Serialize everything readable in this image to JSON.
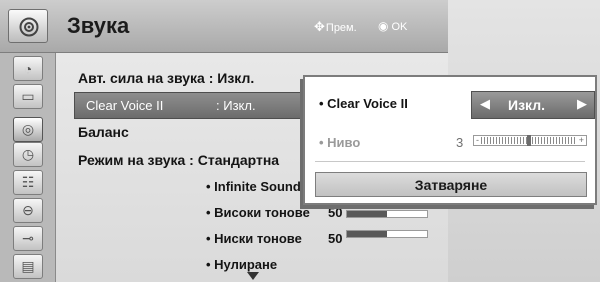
{
  "header": {
    "title": "Звука",
    "icon": "speaker-icon",
    "hint_move": "Прем.",
    "hint_ok": "OK"
  },
  "sidebar": {
    "items": [
      {
        "icon": "satellite-dish-icon"
      },
      {
        "icon": "monitor-icon"
      },
      {
        "icon": "speaker-icon",
        "active": true
      },
      {
        "icon": "clock-icon"
      },
      {
        "icon": "options-icon"
      },
      {
        "icon": "lock-icon"
      },
      {
        "icon": "input-icon"
      },
      {
        "icon": "media-icon"
      }
    ]
  },
  "menu": {
    "avl": "Авт. сила на звука : Изкл.",
    "clear_voice_label": "Clear Voice II",
    "clear_voice_value": ": Изкл.",
    "clear_voice_level": "3",
    "balance": "Баланс",
    "sound_mode": "Режим на звука : Стандартна",
    "sub_items": [
      {
        "label": "• Infinite Sound"
      },
      {
        "label": "• Високи тонове",
        "value": "50",
        "level": 0.5
      },
      {
        "label": "• Ниски тонове",
        "value": "50",
        "level": 0.5
      },
      {
        "label": "• Нулиране"
      }
    ]
  },
  "popup": {
    "clear_voice_label": "• Clear Voice II",
    "selector_value": "Изкл.",
    "level_label": "• Ниво",
    "level_value": "3",
    "level_fraction": 0.5,
    "slider_minus": "-",
    "slider_plus": "+",
    "close_label": "Затваряне"
  },
  "colors": {
    "highlight": "#7a7a7a",
    "selected_text": "#ffffff",
    "disabled_text": "#9a9a9a"
  }
}
